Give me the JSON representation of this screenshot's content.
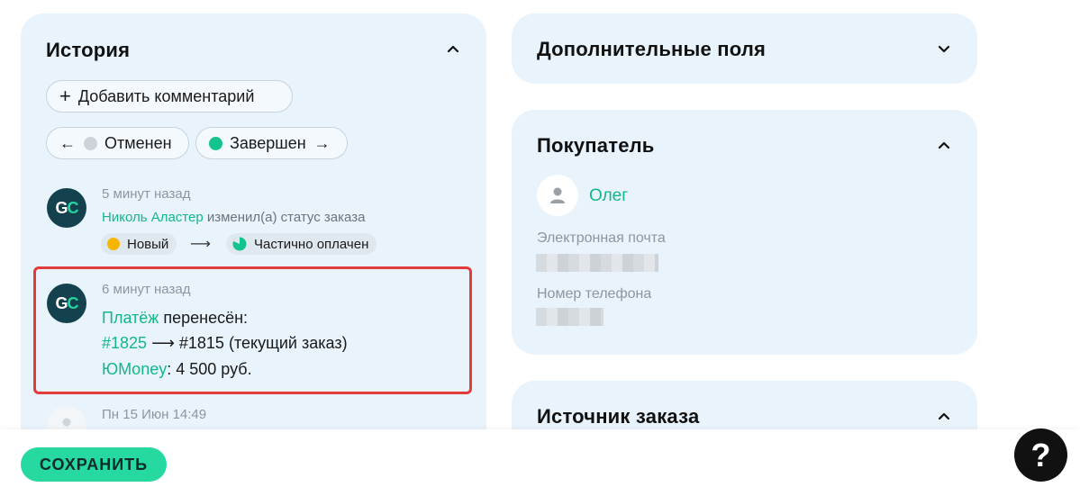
{
  "history": {
    "title": "История",
    "add_comment_label": "Добавить комментарий",
    "prev_status": {
      "label": "Отменен",
      "dot_color": "#cdd3d8"
    },
    "next_status": {
      "label": "Завершен",
      "dot_color": "#13c48e"
    },
    "entries": [
      {
        "avatar": "GC",
        "time": "5 минут назад",
        "author": "Николь Аластер",
        "action": " изменил(а) статус заказа",
        "from_status": "Новый",
        "to_status": "Частично оплачен"
      },
      {
        "avatar": "GC",
        "time": "6 минут назад",
        "payment_word": "Платёж",
        "payment_rest": " перенесён:",
        "from_order": "#1825",
        "to_order": " #1815 (текущий заказ)",
        "provider": "ЮMoney",
        "amount": ": 4 500 руб."
      },
      {
        "time": "Пн 15 Июн 14:49"
      }
    ]
  },
  "extra_fields": {
    "title": "Дополнительные поля"
  },
  "buyer": {
    "title": "Покупатель",
    "name": "Олег",
    "email_label": "Электронная почта",
    "phone_label": "Номер телефона"
  },
  "order_source": {
    "title": "Источник заказа"
  },
  "footer": {
    "save_label": "СОХРАНИТЬ",
    "help_label": "?"
  },
  "colors": {
    "accent": "#25d9a0",
    "link": "#13b886",
    "card_bg": "#e8f3fb",
    "highlight": "#e23b3b",
    "status_new": "#f7b500",
    "status_partial": "#13c48e"
  }
}
